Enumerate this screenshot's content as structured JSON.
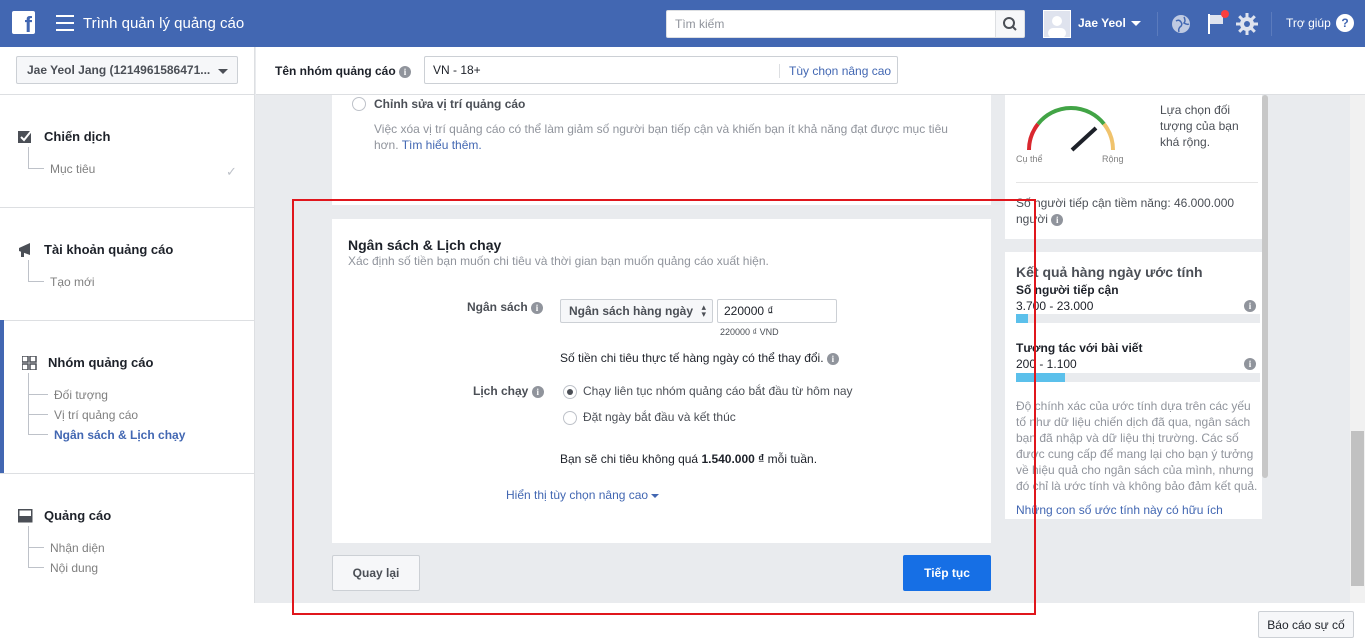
{
  "topbar": {
    "logo": "f",
    "title": "Trình quản lý quảng cáo",
    "search_placeholder": "Tìm kiếm",
    "user_name": "Jae Yeol",
    "help": "Trợ giúp",
    "icons": [
      "menu-icon",
      "search-icon",
      "globe-icon",
      "flag-icon",
      "gear-icon",
      "help-icon"
    ],
    "brand_color": "#4267b2"
  },
  "sidebar": {
    "account": "Jae Yeol Jang (1214961586471...",
    "sections": [
      {
        "title": "Chiến dịch",
        "items": [
          "Mục tiêu"
        ]
      },
      {
        "title": "Tài khoản quảng cáo",
        "items": [
          "Tạo mới"
        ]
      },
      {
        "title": "Nhóm quảng cáo",
        "items": [
          "Đối tượng",
          "Vị trí quảng cáo",
          "Ngân sách & Lịch chạy"
        ]
      },
      {
        "title": "Quảng cáo",
        "items": [
          "Nhận diện",
          "Nội dung"
        ]
      }
    ],
    "active_item": "Ngân sách & Lịch chạy"
  },
  "namebar": {
    "label": "Tên nhóm quảng cáo",
    "value": "VN - 18+",
    "advanced": "Tùy chọn nâng cao"
  },
  "placement": {
    "option": "Chỉnh sửa vị trí quảng cáo",
    "desc": "Việc xóa vị trí quảng cáo có thể làm giảm số người bạn tiếp cận và khiến bạn ít khả năng đạt được mục tiêu hơn.",
    "learn_more": "Tìm hiểu thêm."
  },
  "budget": {
    "title": "Ngân sách & Lịch chạy",
    "subtitle": "Xác định số tiền bạn muốn chi tiêu và thời gian bạn muốn quảng cáo xuất hiện.",
    "budget_label": "Ngân sách",
    "budget_type": "Ngân sách hàng ngày",
    "budget_value": "220000 ₫",
    "budget_hint": "220000 ₫ VND",
    "budget_note": "Số tiền chi tiêu thực tế hàng ngày có thể thay đổi.",
    "schedule_label": "Lịch chạy",
    "schedule_options": [
      "Chạy liên tục nhóm quảng cáo bắt đầu từ hôm nay",
      "Đặt ngày bắt đầu và kết thúc"
    ],
    "weekly_prefix": "Bạn sẽ chi tiêu không quá ",
    "weekly_amount": "1.540.000 ₫",
    "weekly_suffix": " mỗi tuần.",
    "show_advanced": "Hiển thị tùy chọn nâng cao"
  },
  "buttons": {
    "back": "Quay lại",
    "next": "Tiếp tục",
    "report": "Báo cáo sự cố"
  },
  "audience": {
    "narrow": "Cụ thể",
    "wide": "Rộng",
    "desc": "Lựa chọn đối tượng của bạn khá rộng.",
    "reach": "Số người tiếp cận tiềm năng: 46.000.000 người"
  },
  "estimates": {
    "title": "Kết quả hàng ngày ước tính",
    "reach_label": "Số người tiếp cận",
    "reach_value": "3.700 - 23.000",
    "reach_fill": 0.05,
    "engage_label": "Tương tác với bài viết",
    "engage_value": "200 - 1.100",
    "engage_fill": 0.2,
    "accuracy": "Độ chính xác của ước tính dựa trên các yếu tố như dữ liệu chiến dịch đã qua, ngân sách bạn đã nhập và dữ liệu thị trường. Các số được cung cấp để mang lại cho bạn ý tưởng về hiệu quả cho ngân sách của mình, nhưng đó chỉ là ước tính và không bảo đảm kết quả.",
    "helpful": "Những con số ước tính này có hữu ích",
    "bar_color": "#5bc0eb"
  }
}
